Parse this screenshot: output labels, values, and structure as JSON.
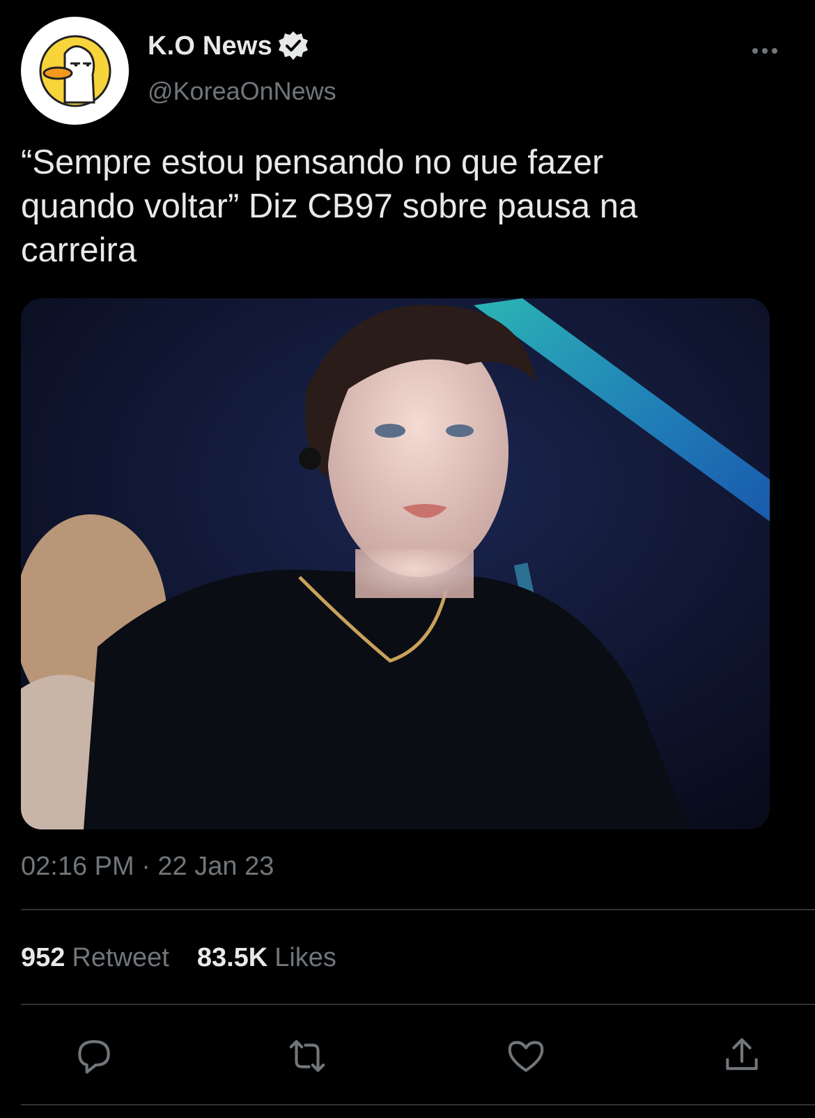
{
  "account": {
    "display_name": "K.O News",
    "handle": "@KoreaOnNews",
    "avatar_icon": "duck-avatar-icon",
    "verified_icon": "verified-badge-icon"
  },
  "tweet": {
    "text": "“Sempre estou pensando no que fazer\nquando voltar” Diz CB97 sobre pausa na\ncarreira",
    "media_alt": "",
    "timestamp": "02:16 PM · 22 Jan 23"
  },
  "stats": {
    "retweet_count": "952",
    "retweet_label": "Retweet",
    "likes_count": "83.5K",
    "likes_label": "Likes"
  },
  "actions": [
    {
      "name": "reply",
      "icon": "reply-icon"
    },
    {
      "name": "retweet",
      "icon": "retweet-icon"
    },
    {
      "name": "like",
      "icon": "heart-icon"
    },
    {
      "name": "share",
      "icon": "share-icon"
    }
  ],
  "colors": {
    "background": "#000000",
    "text_primary": "#e7e9ea",
    "text_secondary": "#71767b",
    "divider": "#2f3336",
    "accent_blue": "#1d9bf0"
  }
}
